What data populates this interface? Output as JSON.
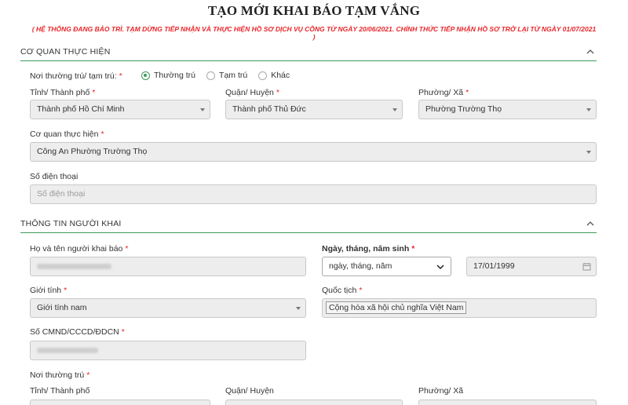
{
  "page_title": "TẠO MỚI KHAI BÁO TẠM VẮNG",
  "notice": "( HỆ THỐNG ĐANG BẢO TRÌ. TẠM DỪNG TIẾP NHẬN VÀ THỰC HIỆN HỒ SƠ DỊCH VỤ CÔNG TỪ NGÀY 20/06/2021. CHÍNH THỨC TIẾP NHẬN HỒ SƠ TRỞ LẠI TỪ NGÀY 01/07/2021 )",
  "section1": {
    "title": "CƠ QUAN THỰC HIỆN",
    "residence_label": "Nơi thường trú/ tạm trú:",
    "residence_options": [
      "Thường trú",
      "Tạm trú",
      "Khác"
    ],
    "residence_selected": "Thường trú",
    "province_label": "Tỉnh/ Thành phố",
    "province_value": "Thành phố Hồ Chí Minh",
    "district_label": "Quận/ Huyện",
    "district_value": "Thành phố Thủ Đức",
    "ward_label": "Phường/ Xã",
    "ward_value": "Phường Trường Thọ",
    "agency_label": "Cơ quan thực hiện",
    "agency_value": "Công An Phường Trường Thọ",
    "phone_label": "Số điện thoại",
    "phone_placeholder": "Số điện thoại"
  },
  "section2": {
    "title": "THÔNG TIN NGƯỜI KHAI",
    "name_label": "Họ và tên người khai báo",
    "dob_label": "Ngày, tháng, năm sinh",
    "dob_format_value": "ngày, tháng, năm",
    "dob_value": "17/01/1999",
    "gender_label": "Giới tính",
    "gender_value": "Giới tính nam",
    "nationality_label": "Quốc tịch",
    "nationality_value": "Cộng hòa xã hội chủ nghĩa Việt Nam",
    "id_label": "Số CMND/CCCD/ĐDCN",
    "permanent_label": "Nơi thường trú",
    "perm_province_label": "Tỉnh/ Thành phố",
    "perm_district_label": "Quận/ Huyện",
    "perm_ward_label": "Phường/ Xã"
  },
  "required_mark": "*",
  "colors": {
    "accent": "#3d9a5c",
    "required": "#e8262a",
    "notice": "#e8262a"
  },
  "icons": [
    "chevron-up-icon",
    "caret-down-icon",
    "calendar-icon",
    "chevron-down-icon"
  ]
}
